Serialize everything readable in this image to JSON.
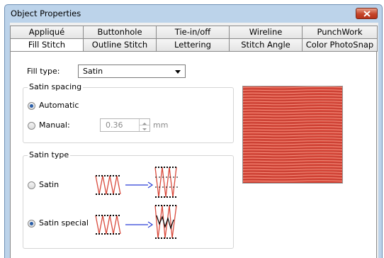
{
  "window": {
    "title": "Object Properties"
  },
  "tabs": {
    "row1": [
      "Appliqué",
      "Buttonhole",
      "Tie-in/off",
      "Wireline",
      "PunchWork"
    ],
    "row2": [
      "Fill Stitch",
      "Outline Stitch",
      "Lettering",
      "Stitch Angle",
      "Color PhotoSnap"
    ]
  },
  "fill": {
    "label": "Fill type:",
    "value": "Satin"
  },
  "spacing": {
    "group_title": "Satin spacing",
    "automatic_label": "Automatic",
    "manual_label": "Manual:",
    "manual_value": "0.36",
    "unit": "mm",
    "selected": "Automatic"
  },
  "satin_type": {
    "group_title": "Satin type",
    "option1_label": "Satin",
    "option2_label": "Satin special",
    "selected": "Satin special"
  },
  "colors": {
    "stitch": "#d94a3c",
    "arrow": "#2b3fd6"
  }
}
